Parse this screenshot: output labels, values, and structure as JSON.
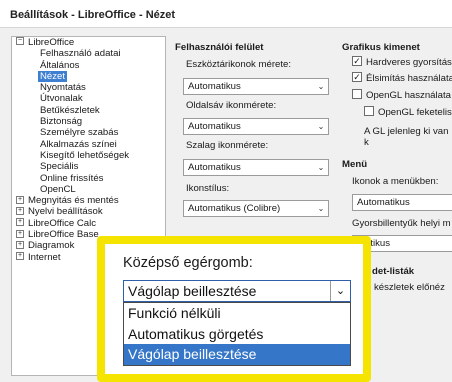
{
  "window": {
    "title": "Beállítások - LibreOffice - Nézet"
  },
  "tree": {
    "items": [
      {
        "label": "LibreOffice",
        "level": 0,
        "expander": "⊟"
      },
      {
        "label": "Felhasználó adatai",
        "level": 1
      },
      {
        "label": "Általános",
        "level": 1
      },
      {
        "label": "Nézet",
        "level": 1,
        "selected": true
      },
      {
        "label": "Nyomtatás",
        "level": 1
      },
      {
        "label": "Útvonalak",
        "level": 1
      },
      {
        "label": "Betűkészletek",
        "level": 1
      },
      {
        "label": "Biztonság",
        "level": 1
      },
      {
        "label": "Személyre szabás",
        "level": 1
      },
      {
        "label": "Alkalmazás színei",
        "level": 1
      },
      {
        "label": "Kisegítő lehetőségek",
        "level": 1
      },
      {
        "label": "Speciális",
        "level": 1
      },
      {
        "label": "Online frissítés",
        "level": 1
      },
      {
        "label": "OpenCL",
        "level": 1
      },
      {
        "label": "Megnyitás és mentés",
        "level": 0,
        "expander": "⊞"
      },
      {
        "label": "Nyelvi beállítások",
        "level": 0,
        "expander": "⊞"
      },
      {
        "label": "LibreOffice Calc",
        "level": 0,
        "expander": "⊞"
      },
      {
        "label": "LibreOffice Base",
        "level": 0,
        "expander": "⊞"
      },
      {
        "label": "Diagramok",
        "level": 0,
        "expander": "⊞"
      },
      {
        "label": "Internet",
        "level": 0,
        "expander": "⊞"
      }
    ]
  },
  "ui": {
    "heading": "Felhasználói felület",
    "toolbar_icon_size_label": "Eszköztárikonok mérete:",
    "toolbar_icon_size_value": "Automatikus",
    "sidebar_icon_size_label": "Oldalsáv ikonmérete:",
    "sidebar_icon_size_value": "Automatikus",
    "tab_icon_size_label": "Szalag ikonmérete:",
    "tab_icon_size_value": "Automatikus",
    "icon_style_label": "Ikonstílus:",
    "icon_style_value": "Automatikus (Colibre)"
  },
  "graphics": {
    "heading": "Grafikus kimenet",
    "hw_accel_label": "Hardveres gyorsítás",
    "hw_accel_checked": true,
    "antialias_label": "Élsimítás használata",
    "antialias_checked": true,
    "opengl_label": "OpenGL használata",
    "opengl_checked": false,
    "opengl_force_label": "OpenGL feketelist",
    "opengl_force_checked": false,
    "gl_status": "A GL jelenleg ki van k"
  },
  "menu": {
    "heading": "Menü",
    "icons_label": "Ikonok a menükben:",
    "icons_value": "Automatikus",
    "shortcuts_label": "Gyorsbillentyűk helyi m",
    "shortcuts_value": "matikus"
  },
  "fontlists": {
    "heading": "det-listák",
    "preview_label": "készletek előnéz"
  },
  "callout": {
    "label": "Középső egérgomb:",
    "selected_value": "Vágólap beillesztése",
    "options": [
      {
        "label": "Funkció nélküli",
        "highlighted": false
      },
      {
        "label": "Automatikus görgetés",
        "highlighted": false
      },
      {
        "label": "Vágólap beillesztése",
        "highlighted": true
      }
    ],
    "frame_color": "#f4e400"
  }
}
